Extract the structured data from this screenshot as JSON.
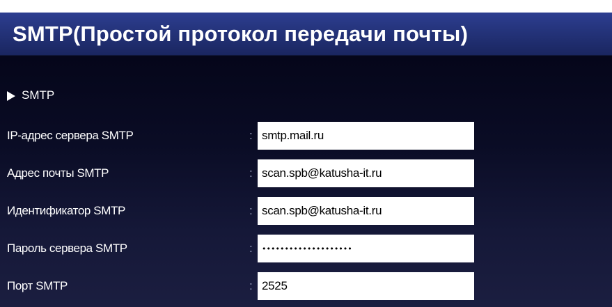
{
  "header": {
    "title": "SMTP(Простой протокол передачи почты)"
  },
  "section": {
    "label": "SMTP"
  },
  "fields": [
    {
      "label": "IP-адрес сервера SMTP",
      "colon": ":",
      "value": "smtp.mail.ru"
    },
    {
      "label": "Адрес почты SMTP",
      "colon": ":",
      "value": "scan.spb@katusha-it.ru"
    },
    {
      "label": "Идентификатор SMTP",
      "colon": ":",
      "value": "scan.spb@katusha-it.ru"
    },
    {
      "label": "Пароль сервера SMTP",
      "colon": ":",
      "value": "••••••••••••••••••••"
    },
    {
      "label": "Порт SMTP",
      "colon": ":",
      "value": "2525"
    }
  ],
  "colors": {
    "header_bg": "#24337a",
    "panel_bg": "#0a0c25",
    "text": "#ffffff"
  }
}
